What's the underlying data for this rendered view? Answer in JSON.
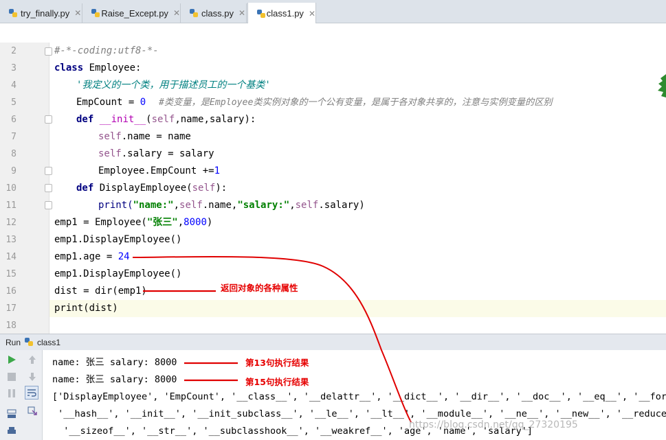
{
  "tabs": [
    {
      "label": "try_finally.py",
      "active": false
    },
    {
      "label": "Raise_Except.py",
      "active": false
    },
    {
      "label": "class.py",
      "active": false
    },
    {
      "label": "class1.py",
      "active": true
    }
  ],
  "editor": {
    "line_numbers": [
      "2",
      "3",
      "4",
      "5",
      "6",
      "7",
      "8",
      "9",
      "10",
      "11",
      "12",
      "13",
      "14",
      "15",
      "16",
      "17",
      "18"
    ],
    "code": {
      "l2": "#-*-coding:utf8-*-",
      "l3_kw": "class",
      "l3_name": " Employee:",
      "l4": "'我定义的一个类，用于描述员工的一个基类'",
      "l5_code": "EmpCount = ",
      "l5_num": "0",
      "l5_comment": "#类变量，是Employee类实例对象的一个公有变量，是属于各对象共享的，注意与实例变量的区别",
      "l6_kw": "def",
      "l6_init": "__init__",
      "l6_self": "self",
      "l6_rest": ",name,salary):",
      "l7_self": "self",
      "l7_rest": ".name = name",
      "l8_self": "self",
      "l8_rest": ".salary = salary",
      "l9_code": "Employee.EmpCount +=",
      "l9_num": "1",
      "l10_kw": "def",
      "l10_name": " DisplayEmployee(",
      "l10_self": "self",
      "l10_rest": "):",
      "l11_print": "print(",
      "l11_s1": "\"name:\"",
      "l11_self1": "self",
      "l11_mid": ".name,",
      "l11_s2": "\"salary:\"",
      "l11_self2": "self",
      "l11_end": ".salary)",
      "l12_code": "emp1 = Employee(",
      "l12_str": "\"张三\"",
      "l12_num": "8000",
      "l12_end": ")",
      "l13": "emp1.DisplayEmployee()",
      "l14_code": "emp1.age = ",
      "l14_num": "24",
      "l15": "emp1.DisplayEmployee()",
      "l16": "dist = dir(emp1)",
      "l17": "print(dist)"
    }
  },
  "run": {
    "title": "Run",
    "config": "class1",
    "output": [
      "name: 张三 salary: 8000",
      "name: 张三 salary: 8000",
      "['DisplayEmployee', 'EmpCount', '__class__', '__delattr__', '__dict__', '__dir__', '__doc__', '__eq__', '__forma",
      " '__hash__', '__init__', '__init_subclass__', '__le__', '__lt__', '__module__', '__ne__', '__new__', '__reduce_",
      "  '__sizeof__', '__str__', '__subclasshook__', '__weakref__', 'age', 'name', 'salary']"
    ]
  },
  "annotations": {
    "dir_note": "返回对象的各种属性",
    "line13_note": "第13句执行结果",
    "line15_note": "第15句执行结果",
    "watermark": "https://blog.csdn.net/qq_27320195",
    "arrow_color": "#e00000"
  }
}
